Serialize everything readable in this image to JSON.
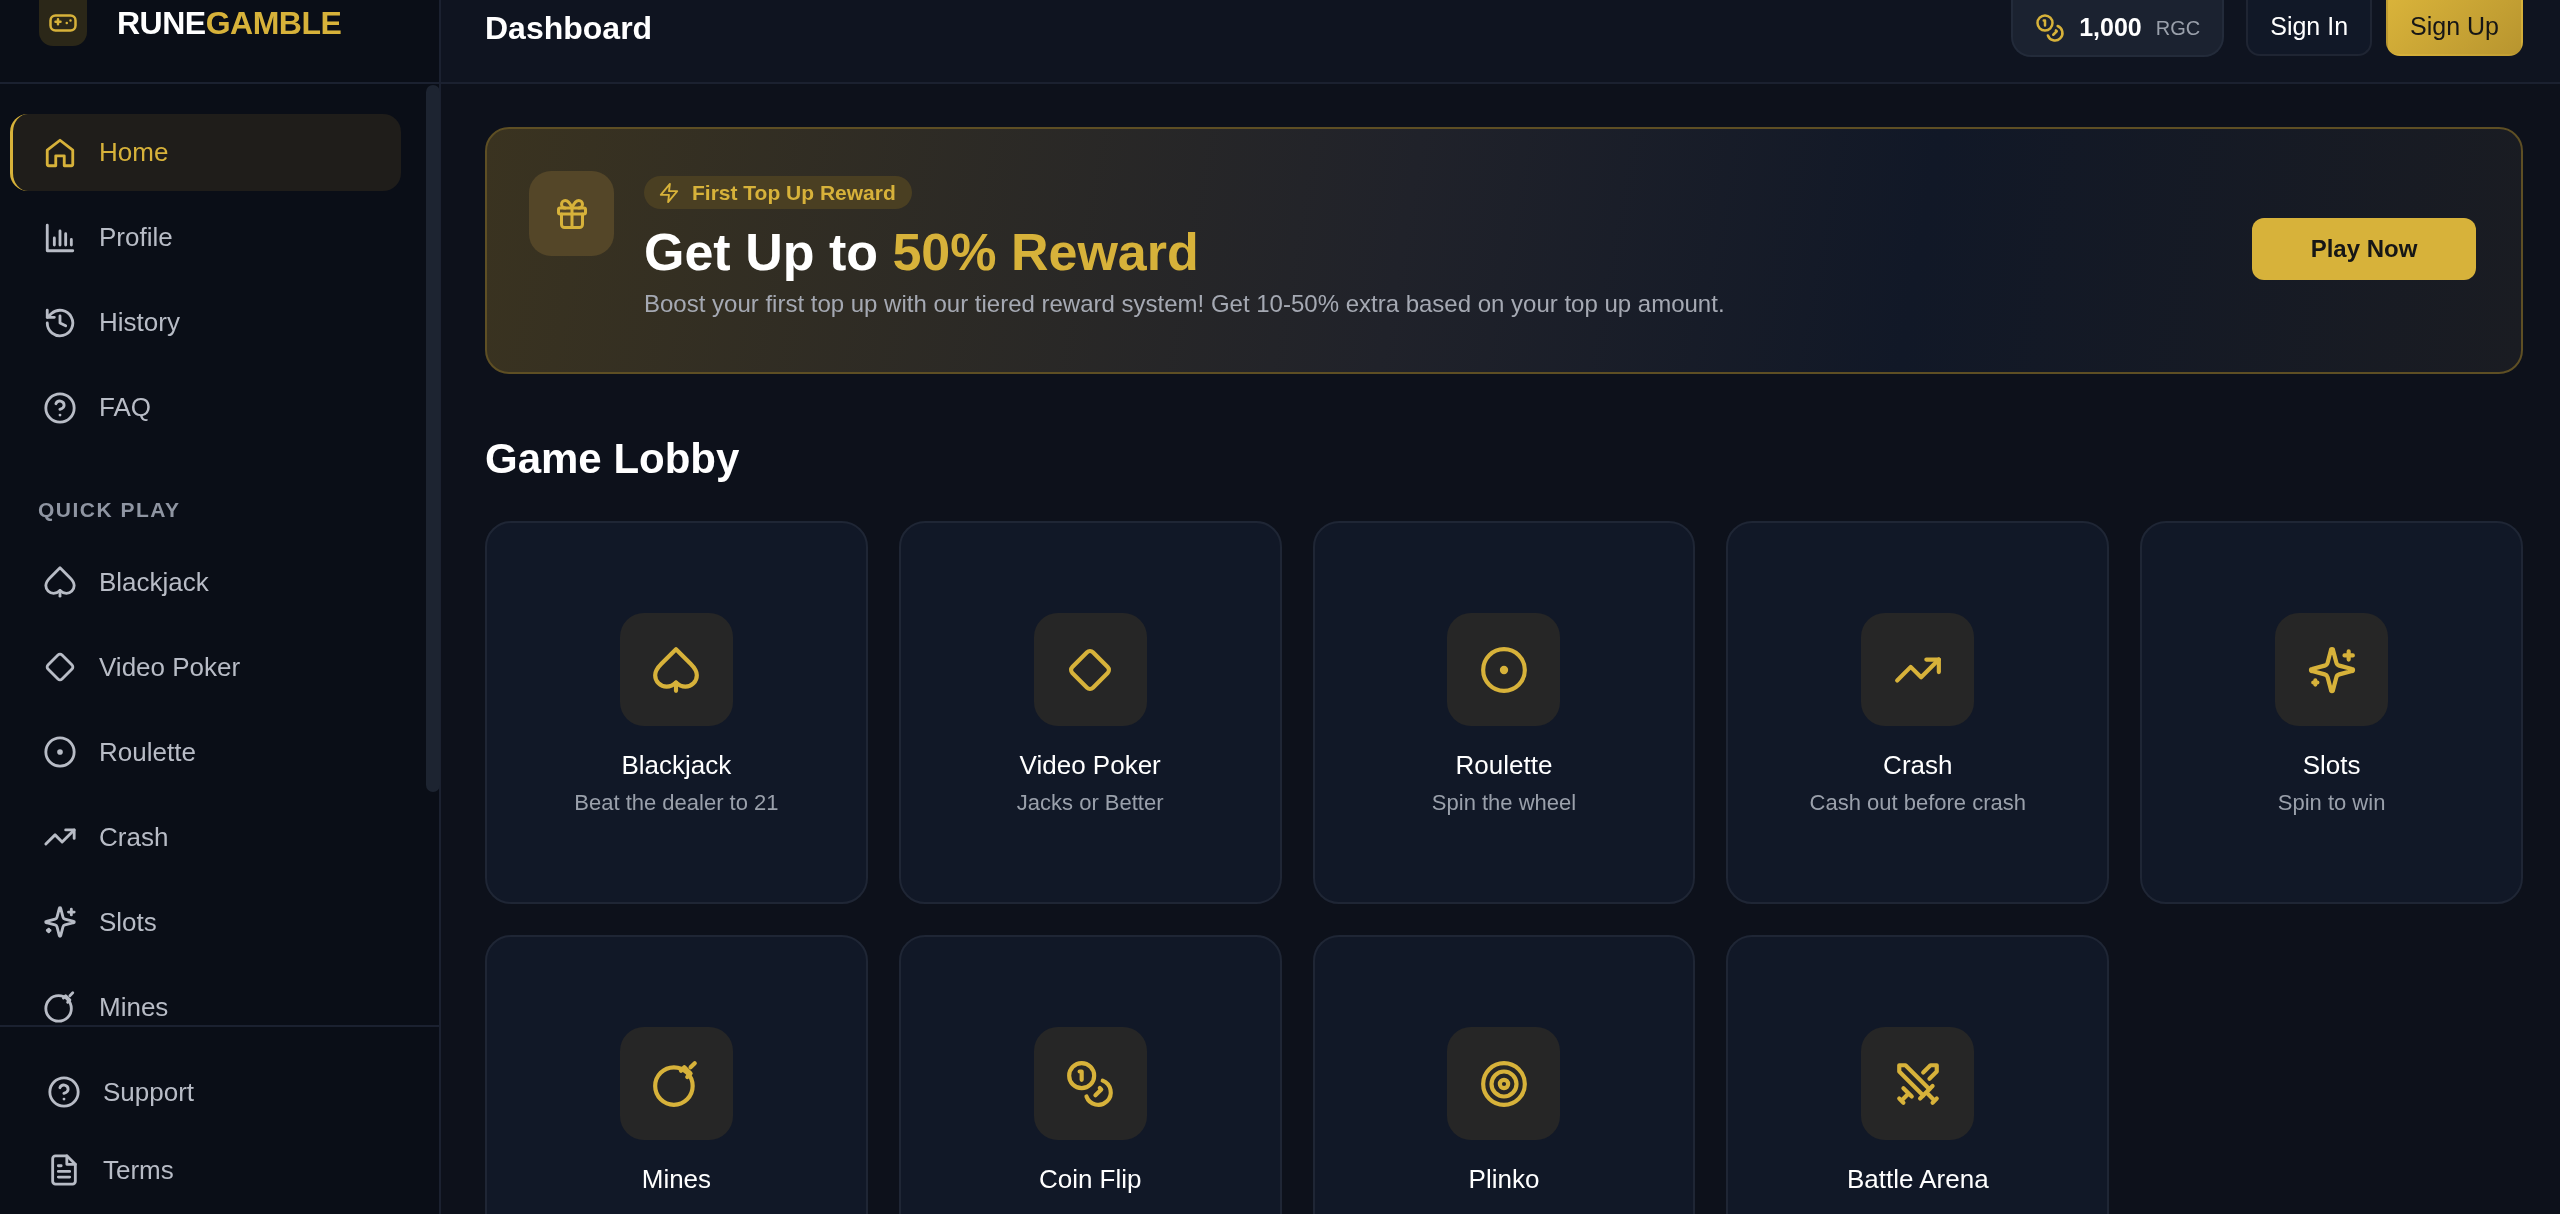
{
  "brand": {
    "first": "RUNE",
    "second": "GAMBLE"
  },
  "header": {
    "title": "Dashboard",
    "balance": "1,000",
    "unit": "RGC",
    "buttons": [
      {
        "label": "Sign In",
        "kind": "outline"
      },
      {
        "label": "Sign Up",
        "kind": "primary"
      }
    ]
  },
  "sidebar": {
    "items": [
      {
        "label": "Home",
        "selected": true
      },
      {
        "label": "Profile",
        "selected": false
      },
      {
        "label": "History",
        "selected": false
      },
      {
        "label": "FAQ",
        "selected": false
      }
    ],
    "section_title": "QUICK PLAY",
    "quick_play": [
      {
        "label": "Blackjack"
      },
      {
        "label": "Video Poker"
      },
      {
        "label": "Roulette"
      },
      {
        "label": "Crash"
      },
      {
        "label": "Slots"
      },
      {
        "label": "Mines"
      }
    ],
    "footer": [
      {
        "label": "Support"
      },
      {
        "label": "Terms"
      }
    ]
  },
  "banner": {
    "badge": "First Top Up Reward",
    "title": "Get Up to",
    "highlight": "50% Reward",
    "description": "Boost your first top up with our tiered reward system! Get 10-50% extra based on your top up amount.",
    "button": "Play Now"
  },
  "lobby": {
    "title": "Game Lobby",
    "games": [
      {
        "title": "Blackjack",
        "subtitle": "Beat the dealer to 21"
      },
      {
        "title": "Video Poker",
        "subtitle": "Jacks or Better"
      },
      {
        "title": "Roulette",
        "subtitle": "Spin the wheel"
      },
      {
        "title": "Crash",
        "subtitle": "Cash out before crash"
      },
      {
        "title": "Slots",
        "subtitle": "Spin to win"
      },
      {
        "title": "Mines"
      },
      {
        "title": "Coin Flip"
      },
      {
        "title": "Plinko"
      },
      {
        "title": "Battle Arena"
      }
    ]
  }
}
